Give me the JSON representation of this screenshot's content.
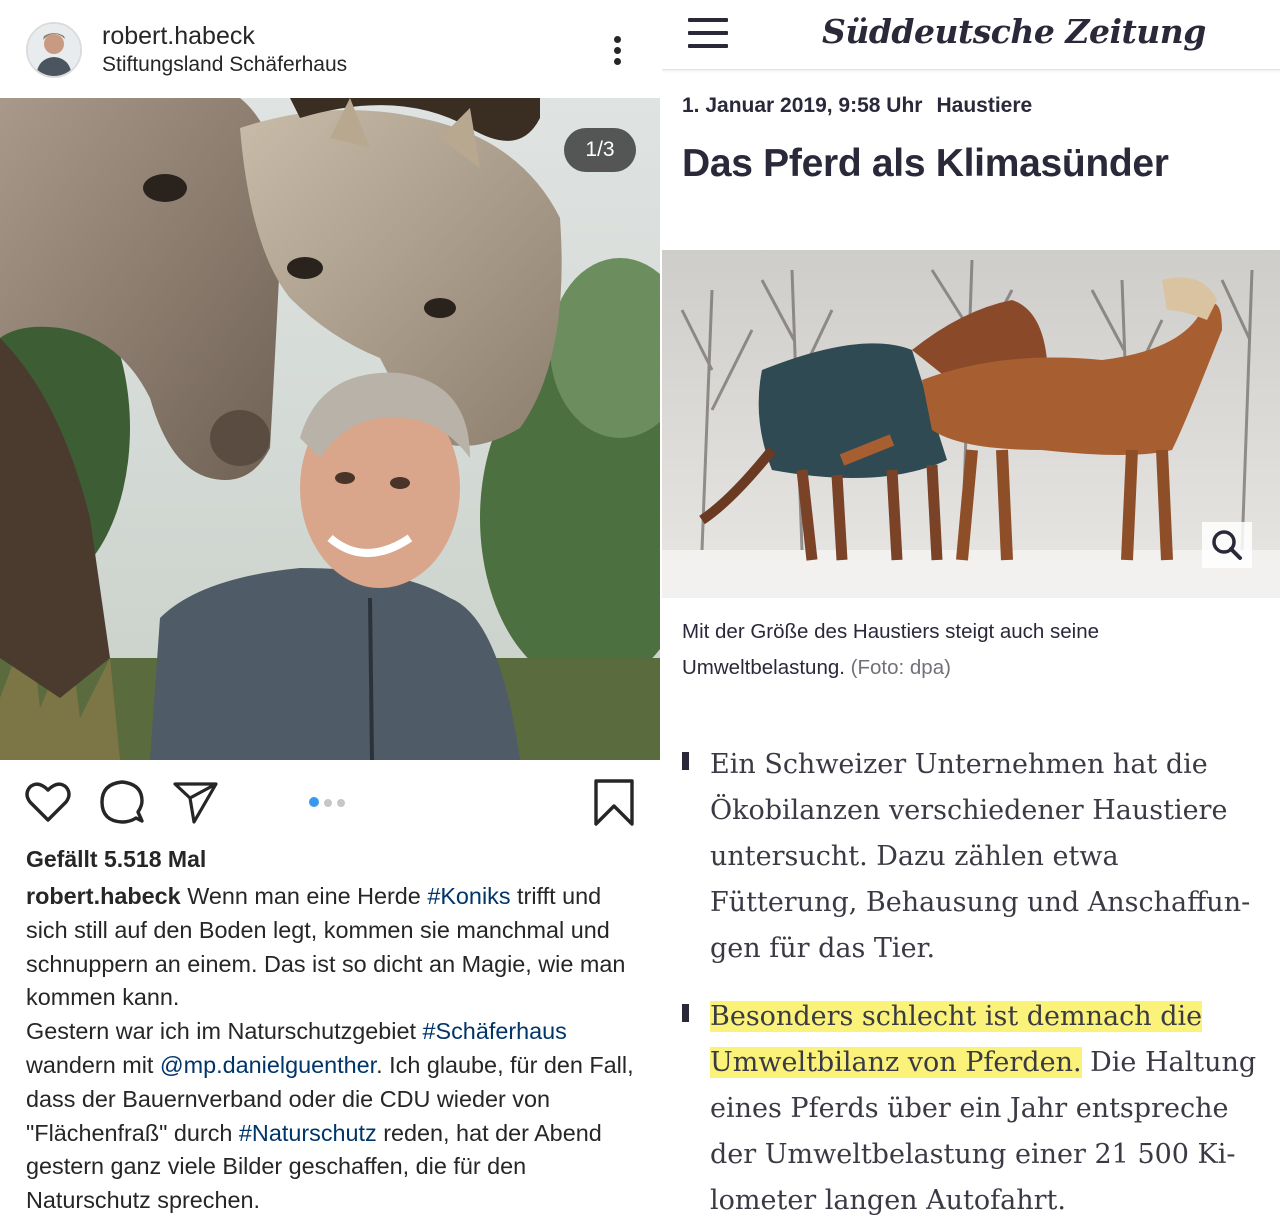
{
  "instagram": {
    "username": "robert.habeck",
    "location": "Stiftungsland Schäferhaus",
    "carousel_counter": "1/3",
    "likes": "Gefällt 5.518 Mal",
    "caption": {
      "username": "robert.habeck",
      "p1": " Wenn man eine Herde ",
      "tag_koniks": "#Koniks",
      "p2": " trifft und sich still auf den Boden legt, kommen sie manchmal und schnuppern an einem. Das ist so dicht an Magie, wie man kommen kann.",
      "p3": "Gestern war ich im Naturschutzgebiet ",
      "tag_schaeferhaus": "#Schäferhaus",
      "p4": " wandern mit ",
      "mention": "@mp.danielguenther",
      "p5": ". Ich glaube, für den Fall, dass der Bauernverband oder die CDU wieder von \"Flächenfraß\" durch ",
      "tag_naturschutz": "#Naturschutz",
      "p6": " reden, hat der Abend gestern ganz viele Bilder geschaffen, die für den Naturschutz sprechen."
    },
    "icons": {
      "like": "heart-icon",
      "comment": "comment-bubble-icon",
      "share": "paper-plane-icon",
      "save": "bookmark-icon",
      "more": "more-vertical-icon"
    },
    "colors": {
      "hashtag": "#003569",
      "active_dot": "#3897f0"
    }
  },
  "sz": {
    "logo": "Süddeutsche Zeitung",
    "date": "1. Januar 2019, 9:58 Uhr",
    "category": "Haustiere",
    "title": "Das Pferd als Klimasünder",
    "photo_caption": "Mit der Größe des Haustiers steigt auch seine Umweltbelastung.",
    "photo_credit": "(Foto: dpa)",
    "bullet1": "Ein Schweizer Unternehmen hat die Ökobilanzen verschiedener Haustiere untersucht. Dazu zählen etwa Fütterung, Behausung und Anschaffun-gen für das Tier.",
    "bullet1_lines": [
      "Ein Schweizer Unternehmen hat die",
      "Ökobilanzen verschiedener Haustiere",
      "untersucht. Dazu zählen etwa",
      "Fütterung, Behausung und Anschaffun-",
      "gen für das Tier."
    ],
    "bullet2_highlight_line1": "Besonders schlecht ist demnach die",
    "bullet2_highlight_line2": "Umweltbilanz von Pferden.",
    "bullet2_rest_line2": " Die Haltung",
    "bullet2_lines": [
      "eines Pferds über ein Jahr entspreche",
      "der Umweltbelastung einer 21 500 Ki-",
      "lometer langen Autofahrt."
    ],
    "icons": {
      "menu": "hamburger-menu-icon",
      "zoom": "magnifier-icon"
    },
    "colors": {
      "highlight": "#fbf27a",
      "text": "#29293a"
    }
  }
}
